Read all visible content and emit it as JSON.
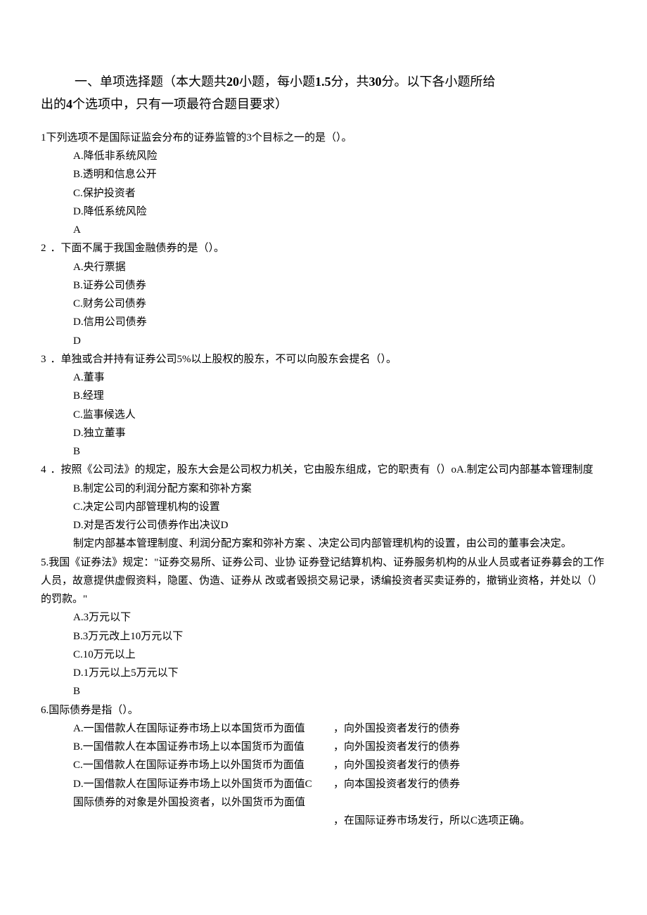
{
  "section_title": {
    "part1": "一、单项选择题（本大题共",
    "n_questions": "20",
    "part2": "小题，每小题",
    "points_each": "1.5",
    "part3": "分，共",
    "total_points": "30",
    "part4": "分。以下各小题所给",
    "line2_part1": "出的",
    "n_options": "4",
    "line2_part2": "个选项中，只有一项最符合题目要求）"
  },
  "q1": {
    "stem": "1下列选项不是国际证监会分布的证券监管的3个目标之一的是（）。",
    "A": "A.降低非系统风险",
    "B": "B.透明和信息公开",
    "C": "C.保护投资者",
    "D": "D.降低系统风险",
    "ans": "A"
  },
  "q2": {
    "num": "2",
    "stem": "．下面不属于我国金融债券的是（）。",
    "A": "A.央行票据",
    "B": "B.证券公司债券",
    "C": "C.财务公司债券",
    "D": "D.信用公司债券",
    "ans": "D"
  },
  "q3": {
    "num": "3",
    "stem": "．单独或合并持有证券公司5%以上股权的股东，不可以向股东会提名（）。",
    "A": "A.董事",
    "B": "B.经理",
    "C": "C.监事候选人",
    "D": "D.独立董事",
    "ans": "B"
  },
  "q4": {
    "num": "4",
    "stem": "．按照《公司法》的规定，股东大会是公司权力机关，它由股东组成，它的职责有（）oA.制定公司内部基本管理制度",
    "B": "B.制定公司的利润分配方案和弥补方案",
    "C": "C.决定公司内部管理机构的设置",
    "D": "D.对是否发行公司债券作出决议D",
    "explain": "制定内部基本管理制度、利润分配方案和弥补方案  、决定公司内部管理机构的设置，由公司的董事会决定。"
  },
  "q5": {
    "stem": "5.我国《证券法》规定：\"证券交易所、证券公司、业协 证券登记结算机构、证券服务机构的从业人员或者证券募会的工作人员，故意提供虚假资料，隐匿、伪造、证券从 改或者毁损交易记录，诱编投资者买卖证券的，撤销业资格，并处以（）的罚款。\"",
    "A": "A.3万元以下",
    "B": "B.3万元改上10万元以下",
    "C": "C.10万元以上",
    "D": "D.1万元以上5万元以下",
    "ans": "B"
  },
  "q6": {
    "stem": "6.国际债券是指（）。",
    "A_left": "A.一国借款人在国际证券市场上以本国货币为面值",
    "A_right": "，向外国投资者发行的债券",
    "B_left": "B.一国借款人在本国证券市场上以本国货币为面值",
    "B_right": "，向外国投资者发行的债券",
    "C_left": "C.一国借款人在国际证券市场上以外国货币为面值",
    "C_right": "，向外国投资者发行的债券",
    "D_left": "D.一国借款人在国际证券市场上以外国货币为面值C",
    "D_right": "，向本国投资者发行的债券",
    "explain_left": "国际债券的对象是外国投资者，以外国货币为面值",
    "explain_right": "，在国际证券市场发行，所以C选项正确。"
  }
}
